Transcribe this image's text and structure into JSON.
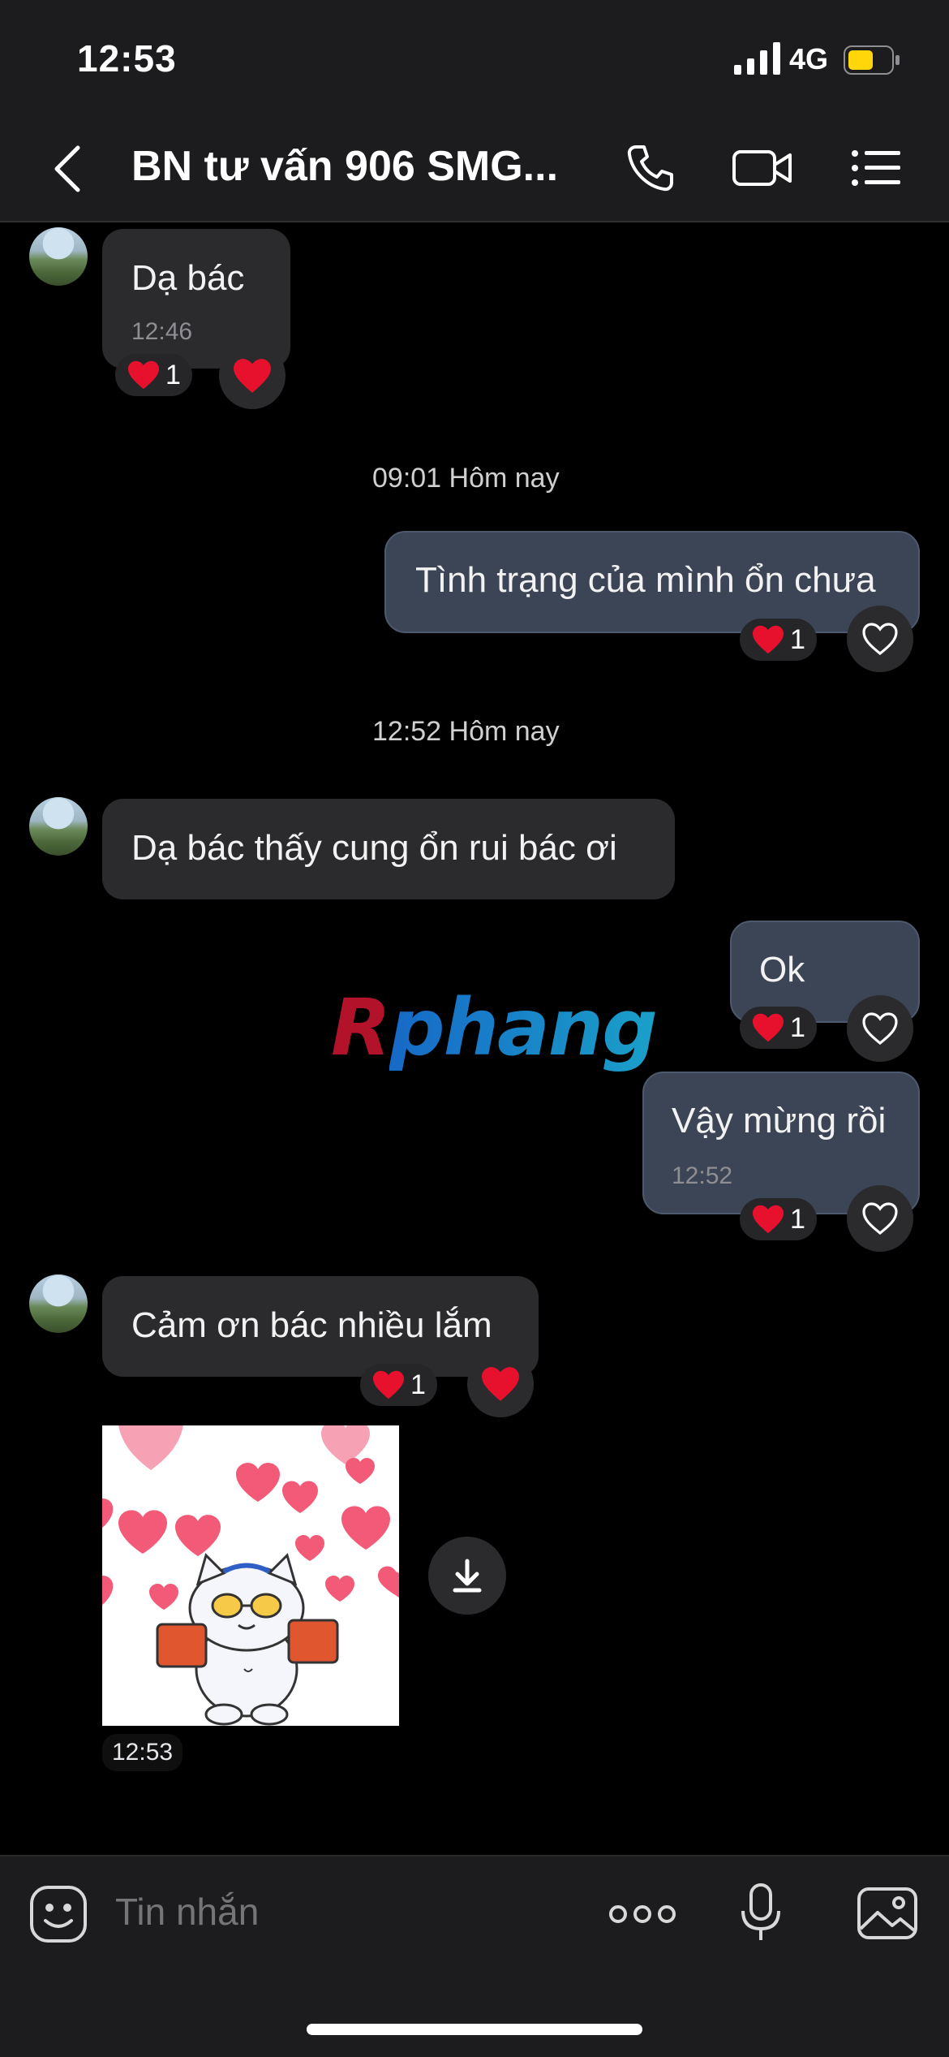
{
  "status": {
    "time": "12:53",
    "network": "4G"
  },
  "header": {
    "title": "BN tư vấn 906 SMG..."
  },
  "messages": [
    {
      "text": "Dạ bác",
      "time": "12:46",
      "reaction_count": "1"
    },
    {
      "divider": "09:01 Hôm nay"
    },
    {
      "text": "Tình trạng của mình ổn chưa",
      "reaction_count": "1"
    },
    {
      "divider": "12:52 Hôm nay"
    },
    {
      "text": "Dạ bác thấy cung ổn rui bác ơi"
    },
    {
      "text": "Ok",
      "reaction_count": "1"
    },
    {
      "text": "Vậy mừng rồi",
      "time": "12:52",
      "reaction_count": "1"
    },
    {
      "text": "Cảm ơn bác nhiều lắm",
      "reaction_count": "1"
    },
    {
      "sticker_time": "12:53"
    }
  ],
  "watermark": {
    "first": "R",
    "rest": "phang"
  },
  "input": {
    "placeholder": "Tin nhắn"
  },
  "colors": {
    "incoming": "#2b2b2d",
    "outgoing": "#3b4555",
    "heart": "#e8112d"
  }
}
